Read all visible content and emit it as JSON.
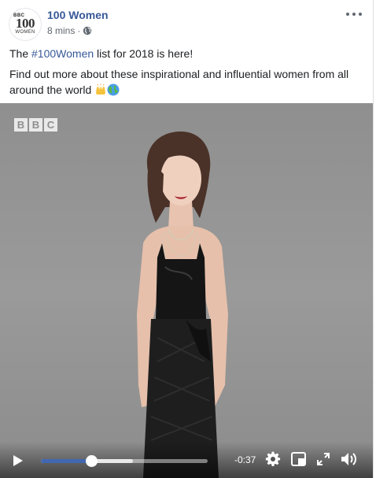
{
  "post": {
    "page_name": "100 Women",
    "time": "8 mins",
    "separator": "·",
    "audience_icon": "globe-icon",
    "more_icon": "more-options-icon",
    "avatar": {
      "line1": "BBC",
      "line2": "100",
      "line3": "WOMEN"
    },
    "text": {
      "prefix": "The ",
      "hashtag": "#100Women",
      "suffix": " list for 2018 is here!",
      "line2": "Find out more about these inspirational and influential women from all around the world",
      "emojis": [
        "raising-hands-emoji",
        "globe-emoji"
      ]
    }
  },
  "video": {
    "watermark": [
      "B",
      "B",
      "C"
    ],
    "time_remaining": "-0:37",
    "progress": 0.3,
    "buffered": 0.55,
    "controls": [
      "play-icon",
      "settings-gear-icon",
      "mini-player-icon",
      "fullscreen-icon",
      "volume-icon"
    ]
  },
  "colors": {
    "link": "#385898",
    "progress": "#4267b2",
    "text": "#1c1e21",
    "meta": "#616770"
  }
}
